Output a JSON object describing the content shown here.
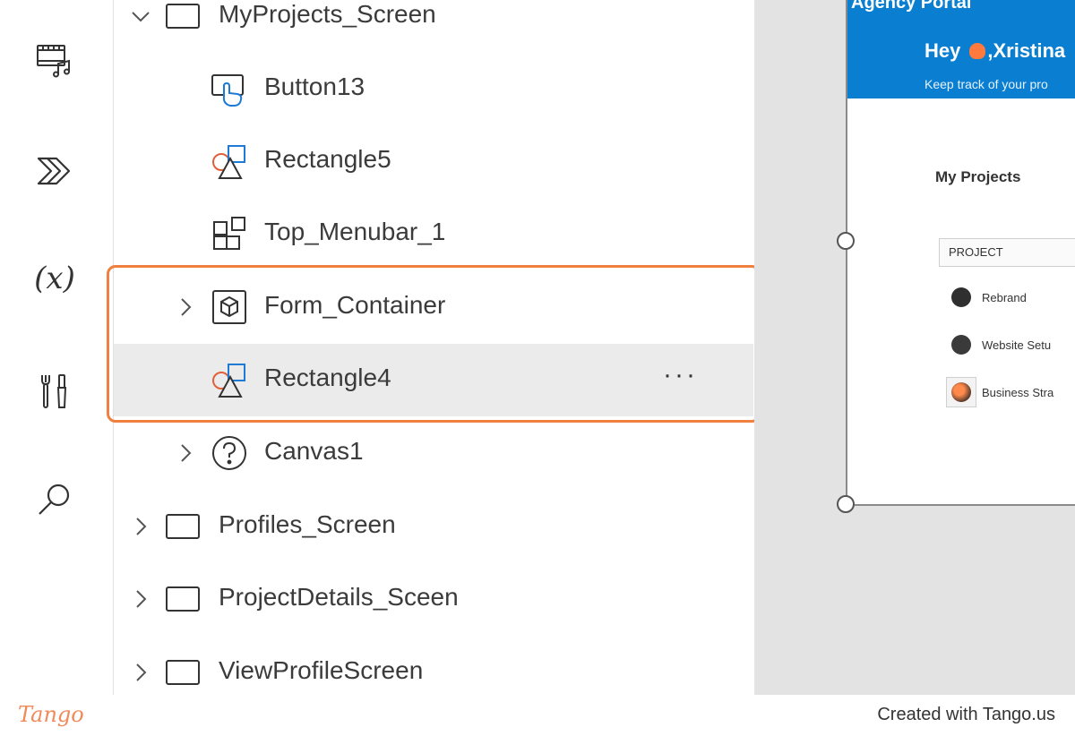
{
  "rail": {
    "items": [
      {
        "icon": "media-icon"
      },
      {
        "icon": "power-automate-icon"
      },
      {
        "icon": "variables-icon",
        "glyph": "(x)"
      },
      {
        "icon": "tools-icon"
      },
      {
        "icon": "search-icon"
      }
    ]
  },
  "tree": {
    "items": [
      {
        "label": "MyProjects_Screen",
        "icon": "screen-icon",
        "expanded": true
      },
      {
        "label": "Button13",
        "icon": "button-control-icon"
      },
      {
        "label": "Rectangle5",
        "icon": "shapes-icon"
      },
      {
        "label": "Top_Menubar_1",
        "icon": "component-icon"
      },
      {
        "label": "Form_Container",
        "icon": "container-icon",
        "expanded": false
      },
      {
        "label": "Rectangle4",
        "icon": "shapes-icon",
        "selected": true,
        "more": "···"
      },
      {
        "label": "Canvas1",
        "icon": "help-circle-icon",
        "expanded": false
      },
      {
        "label": "Profiles_Screen",
        "icon": "screen-icon",
        "expanded": false
      },
      {
        "label": "ProjectDetails_Sceen",
        "icon": "screen-icon",
        "expanded": false
      },
      {
        "label": "ViewProfileScreen",
        "icon": "screen-icon",
        "expanded": false
      }
    ]
  },
  "preview": {
    "title": "Agency Portal",
    "greeting_pre": "Hey",
    "greeting_name": ",Xristina",
    "subtitle": "Keep track of your pro",
    "heading": "My Projects",
    "column_header": "PROJECT",
    "projects": [
      "Rebrand",
      "Website Setu",
      "Business Stra"
    ],
    "banner_color": "#0a7fd1"
  },
  "footer": {
    "logo": "Tango",
    "credit": "Created with Tango.us"
  },
  "colors": {
    "highlight": "#f08040",
    "selected_row": "#ebebeb",
    "canvas_bg": "#e3e3e3"
  }
}
